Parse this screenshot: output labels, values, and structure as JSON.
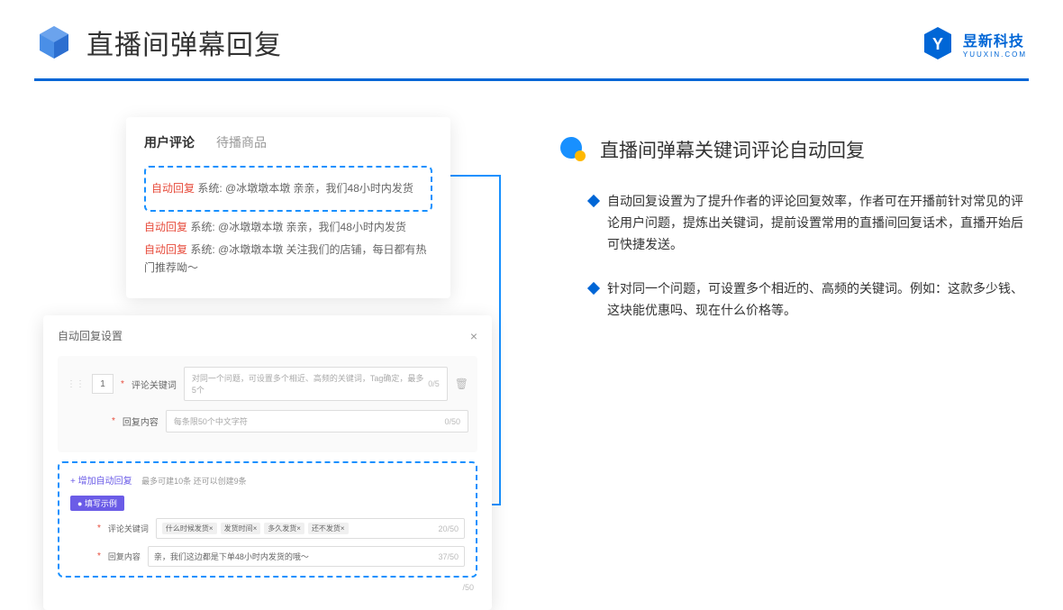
{
  "header": {
    "title": "直播间弹幕回复"
  },
  "brand": {
    "name": "昱新科技",
    "url": "YUUXIN.COM"
  },
  "card1": {
    "tab1": "用户评论",
    "tab2": "待播商品",
    "comments": [
      {
        "tag": "自动回复",
        "text": "系统: @冰墩墩本墩 亲亲，我们48小时内发货"
      },
      {
        "tag": "自动回复",
        "text": "系统: @冰墩墩本墩 亲亲，我们48小时内发货"
      },
      {
        "tag": "自动回复",
        "text": "系统: @冰墩墩本墩 关注我们的店铺，每日都有热门推荐呦～"
      }
    ]
  },
  "card2": {
    "title": "自动回复设置",
    "num": "1",
    "kw_label": "评论关键词",
    "kw_ph": "对同一个问题，可设置多个相近、高频的关键词，Tag确定，最多5个",
    "kw_count": "0/5",
    "content_label": "回复内容",
    "content_ph": "每条限50个中文字符",
    "content_count": "0/50",
    "add_link": "+ 增加自动回复",
    "add_hint": "最多可建10条 还可以创建9条",
    "example_badge": "● 填写示例",
    "ex_kw_label": "评论关键词",
    "ex_tags": [
      "什么时候发货×",
      "发货时间×",
      "多久发货×",
      "还不发货×"
    ],
    "ex_kw_count": "20/50",
    "ex_content_label": "回复内容",
    "ex_content": "亲，我们这边都是下单48小时内发货的哦～",
    "ex_content_count": "37/50",
    "outer_count": "/50"
  },
  "right": {
    "section_title": "直播间弹幕关键词评论自动回复",
    "bullets": [
      "自动回复设置为了提升作者的评论回复效率，作者可在开播前针对常见的评论用户问题，提炼出关键词，提前设置常用的直播间回复话术，直播开始后可快捷发送。",
      "针对同一个问题，可设置多个相近的、高频的关键词。例如：这款多少钱、这块能优惠吗、现在什么价格等。"
    ]
  }
}
